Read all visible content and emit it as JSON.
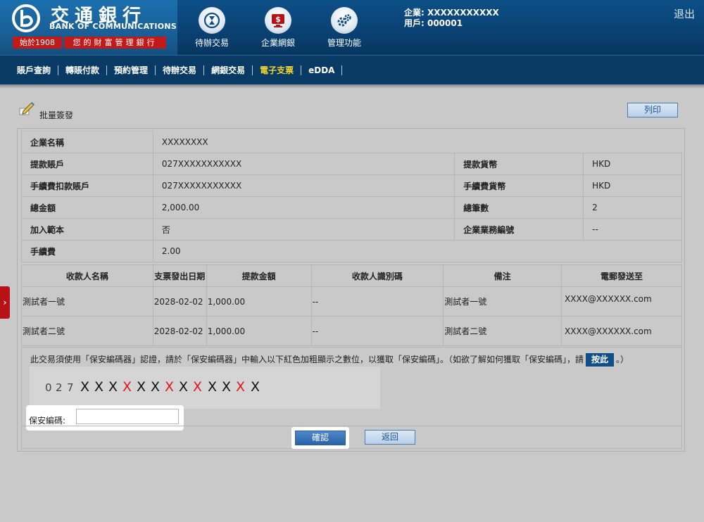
{
  "brand": {
    "name_cn": "交通銀行",
    "name_en": "BANK OF COMMUNICATIONS",
    "since": "始於1908",
    "slogan": "您的財富管理銀行"
  },
  "top_nav": [
    {
      "label": "待辦交易",
      "icon": "hourglass-icon"
    },
    {
      "label": "企業網銀",
      "icon": "dollar-monitor-icon"
    },
    {
      "label": "管理功能",
      "icon": "gears-icon"
    }
  ],
  "company": {
    "company_label": "企業: XXXXXXXXXXX",
    "user_label": "用戶: 000001"
  },
  "logout_label": "退出",
  "menu": [
    {
      "label": "賬戶查詢",
      "active": false
    },
    {
      "label": "轉賬付款",
      "active": false
    },
    {
      "label": "預約管理",
      "active": false
    },
    {
      "label": "待辦交易",
      "active": false
    },
    {
      "label": "網銀交易",
      "active": false
    },
    {
      "label": "電子支票",
      "active": true
    },
    {
      "label": "eDDA",
      "active": false
    }
  ],
  "side_tab": "›",
  "panel": {
    "title": "批量簽發",
    "print_label": "列印"
  },
  "details": {
    "company_name_label": "企業名稱",
    "company_name": "XXXXXXXX",
    "withdraw_account_label": "提款賬戶",
    "withdraw_account": "027XXXXXXXXXXX",
    "withdraw_currency_label": "提款貨幣",
    "withdraw_currency": "HKD",
    "fee_account_label": "手續費扣款賬戶",
    "fee_account": "027XXXXXXXXXXX",
    "fee_currency_label": "手續費貨幣",
    "fee_currency": "HKD",
    "total_amount_label": "總金額",
    "total_amount": "2,000.00",
    "total_count_label": "總筆數",
    "total_count": "2",
    "add_template_label": "加入範本",
    "add_template": "否",
    "business_no_label": "企業業務編號",
    "business_no": "--",
    "fee_label": "手續費",
    "fee": "2.00"
  },
  "payee_table": {
    "headers": [
      "收款人名稱",
      "支票發出日期",
      "提款金額",
      "收款人識別碼",
      "備注",
      "電郵發送至"
    ],
    "rows": [
      [
        "測試者一號",
        "2028-02-02",
        "1,000.00",
        "--",
        "測試者一號",
        "XXXX@XXXXXX.com"
      ],
      [
        "測試者二號",
        "2028-02-02",
        "1,000.00",
        "--",
        "測試者二號",
        "XXXX@XXXXXX.com"
      ]
    ]
  },
  "security": {
    "instruction_before": "此交易須使用「保安編碼器」認證，請於「保安編碼器」中輸入以下紅色加粗顯示之數位，以獲取「保安編碼」。（如欲了解如何獲取「保安編碼」，請",
    "click_here": "按此",
    "instruction_after": "。）",
    "digits": [
      {
        "c": "0",
        "kind": "gray"
      },
      {
        "c": "2",
        "kind": "gray"
      },
      {
        "c": "7",
        "kind": "gray"
      },
      {
        "c": "X",
        "kind": "black"
      },
      {
        "c": "X",
        "kind": "black"
      },
      {
        "c": "X",
        "kind": "black"
      },
      {
        "c": "X",
        "kind": "red"
      },
      {
        "c": "X",
        "kind": "black"
      },
      {
        "c": "X",
        "kind": "black"
      },
      {
        "c": "X",
        "kind": "red"
      },
      {
        "c": "X",
        "kind": "black"
      },
      {
        "c": "X",
        "kind": "red"
      },
      {
        "c": "X",
        "kind": "black"
      },
      {
        "c": "X",
        "kind": "black"
      },
      {
        "c": "X",
        "kind": "red"
      },
      {
        "c": "X",
        "kind": "black"
      }
    ],
    "code_label": "保安編碼:",
    "code_value": "",
    "confirm_label": "確認",
    "back_label": "返回"
  },
  "colors": {
    "header": "#0a4274",
    "menubar": "#083a65",
    "active_menu": "#f2d434",
    "red_digit": "#e0161c",
    "brand_red": "#c11a1a"
  }
}
